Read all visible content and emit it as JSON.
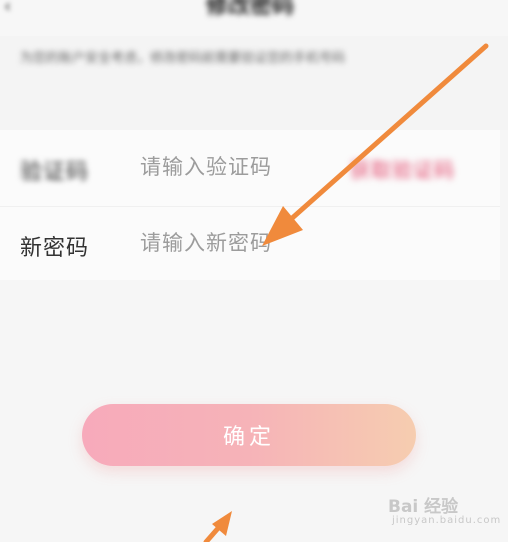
{
  "header": {
    "back_icon": "back-arrow-icon",
    "title": "修改密码"
  },
  "notice": {
    "text": "为您的账户安全考虑，修改密码前需要验证您的手机号码"
  },
  "form": {
    "code_label": "验证码",
    "code_placeholder": "请输入验证码",
    "get_code_label": "获取验证码",
    "password_label": "新密码",
    "password_placeholder": "请输入新密码"
  },
  "confirm_button": {
    "label": "确定"
  },
  "watermark": {
    "brand": "Bai 经验",
    "url": "jingyan.baidu.com"
  },
  "colors": {
    "accent": "#e2456a",
    "annotation_arrow": "#f08a3c",
    "button_start": "#f7aabb",
    "button_end": "#f6cdb0"
  }
}
